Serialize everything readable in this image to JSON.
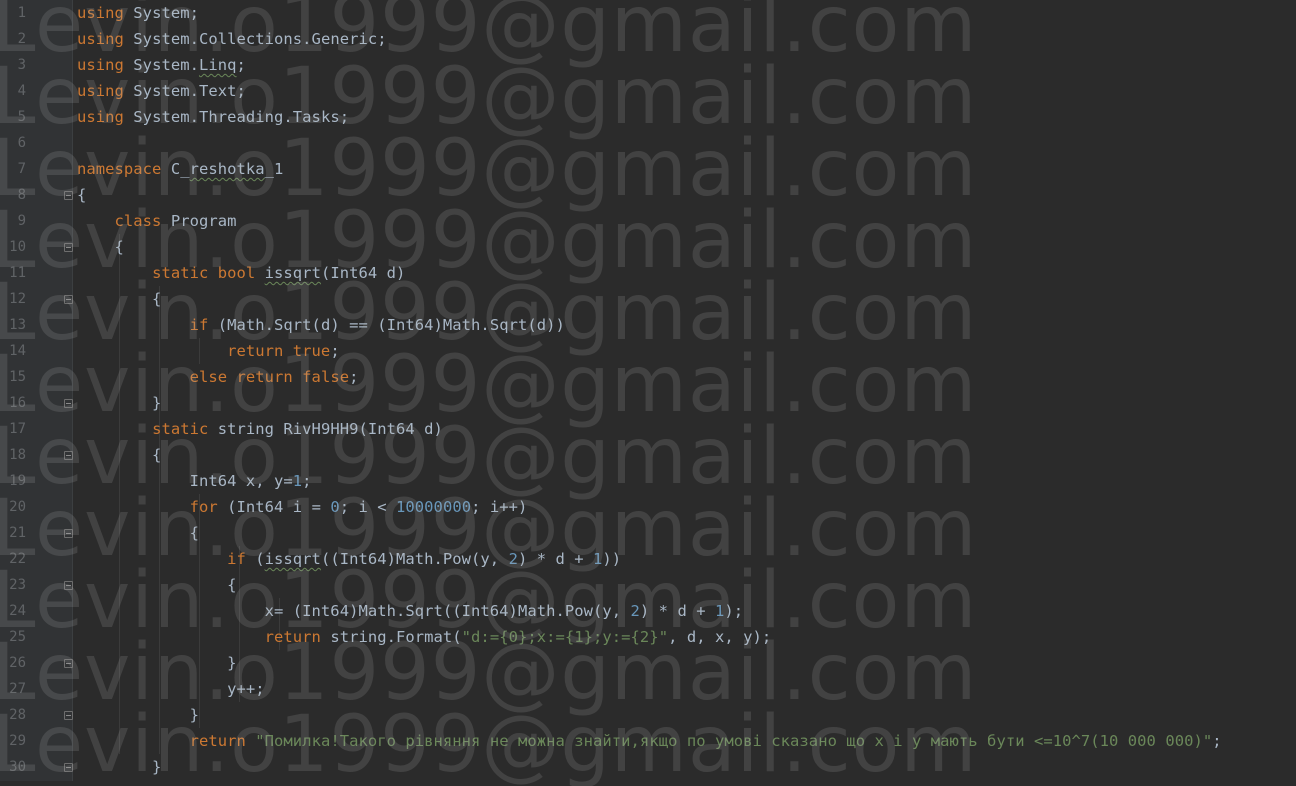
{
  "editor": {
    "line_numbers": [
      "1",
      "2",
      "3",
      "4",
      "5",
      "6",
      "7",
      "8",
      "9",
      "10",
      "11",
      "12",
      "13",
      "14",
      "15",
      "16",
      "17",
      "18",
      "19",
      "20",
      "21",
      "22",
      "23",
      "24",
      "25",
      "26",
      "27",
      "28",
      "29",
      "30"
    ],
    "lines": [
      [
        {
          "t": "using",
          "c": "kw"
        },
        {
          "t": " System;"
        }
      ],
      [
        {
          "t": "using",
          "c": "kw"
        },
        {
          "t": " System.Collections.Generic;"
        }
      ],
      [
        {
          "t": "using",
          "c": "kw"
        },
        {
          "t": " System."
        },
        {
          "t": "Linq",
          "c": "typo"
        },
        {
          "t": ";"
        }
      ],
      [
        {
          "t": "using",
          "c": "kw"
        },
        {
          "t": " System.Text;"
        }
      ],
      [
        {
          "t": "using",
          "c": "kw"
        },
        {
          "t": " System.Threading.Tasks;"
        }
      ],
      [],
      [
        {
          "t": "namespace",
          "c": "kw"
        },
        {
          "t": " C_"
        },
        {
          "t": "reshotka",
          "c": "typo"
        },
        {
          "t": "_1"
        }
      ],
      [
        {
          "t": "{"
        }
      ],
      [
        {
          "t": "    "
        },
        {
          "t": "class",
          "c": "kw"
        },
        {
          "t": " Program"
        }
      ],
      [
        {
          "t": "    {"
        }
      ],
      [
        {
          "t": "        "
        },
        {
          "t": "static bool",
          "c": "kw"
        },
        {
          "t": " "
        },
        {
          "t": "issqrt",
          "c": "typo"
        },
        {
          "t": "(Int64 d)"
        }
      ],
      [
        {
          "t": "        {"
        }
      ],
      [
        {
          "t": "            "
        },
        {
          "t": "if",
          "c": "kw"
        },
        {
          "t": " (Math.Sqrt(d) == (Int64)Math.Sqrt(d))"
        }
      ],
      [
        {
          "t": "                "
        },
        {
          "t": "return true",
          "c": "kw"
        },
        {
          "t": ";"
        }
      ],
      [
        {
          "t": "            "
        },
        {
          "t": "else return false",
          "c": "kw"
        },
        {
          "t": ";"
        }
      ],
      [
        {
          "t": "        }"
        }
      ],
      [
        {
          "t": "        "
        },
        {
          "t": "static",
          "c": "kw"
        },
        {
          "t": " string RivH9HH9(Int64 d)"
        }
      ],
      [
        {
          "t": "        {"
        }
      ],
      [
        {
          "t": "            Int64 x, y="
        },
        {
          "t": "1",
          "c": "num"
        },
        {
          "t": ";"
        }
      ],
      [
        {
          "t": "            "
        },
        {
          "t": "for",
          "c": "kw"
        },
        {
          "t": " (Int64 i = "
        },
        {
          "t": "0",
          "c": "num"
        },
        {
          "t": "; i < "
        },
        {
          "t": "10000000",
          "c": "num"
        },
        {
          "t": "; i++)"
        }
      ],
      [
        {
          "t": "            {"
        }
      ],
      [
        {
          "t": "                "
        },
        {
          "t": "if",
          "c": "kw"
        },
        {
          "t": " ("
        },
        {
          "t": "issqrt",
          "c": "typo"
        },
        {
          "t": "((Int64)Math.Pow(y, "
        },
        {
          "t": "2",
          "c": "num"
        },
        {
          "t": ") * d + "
        },
        {
          "t": "1",
          "c": "num"
        },
        {
          "t": "))"
        }
      ],
      [
        {
          "t": "                {"
        }
      ],
      [
        {
          "t": "                    x= (Int64)Math.Sqrt((Int64)Math.Pow(y, "
        },
        {
          "t": "2",
          "c": "num"
        },
        {
          "t": ") * d + "
        },
        {
          "t": "1",
          "c": "num"
        },
        {
          "t": ");"
        }
      ],
      [
        {
          "t": "                    "
        },
        {
          "t": "return",
          "c": "kw"
        },
        {
          "t": " string.Format("
        },
        {
          "t": "\"d:={0};x:={1};y:={2}\"",
          "c": "str"
        },
        {
          "t": ", d, x, y);"
        }
      ],
      [
        {
          "t": "                }"
        }
      ],
      [
        {
          "t": "                y++;"
        }
      ],
      [
        {
          "t": "            }"
        }
      ],
      [
        {
          "t": "            "
        },
        {
          "t": "return",
          "c": "kw"
        },
        {
          "t": " "
        },
        {
          "t": "\"Помилка!Такого рівняння не можна знайти,якщо по умові сказано що x і y мають бути <=10^7(10 000 000)\"",
          "c": "str"
        },
        {
          "t": ";"
        }
      ],
      [
        {
          "t": "        }"
        }
      ]
    ],
    "fold_markers": [
      {
        "line": 8,
        "kind": "open"
      },
      {
        "line": 10,
        "kind": "open"
      },
      {
        "line": 12,
        "kind": "open"
      },
      {
        "line": 16,
        "kind": "close"
      },
      {
        "line": 18,
        "kind": "open"
      },
      {
        "line": 21,
        "kind": "open"
      },
      {
        "line": 23,
        "kind": "open"
      },
      {
        "line": 26,
        "kind": "close"
      },
      {
        "line": 28,
        "kind": "close"
      },
      {
        "line": 30,
        "kind": "close"
      }
    ]
  },
  "watermark": {
    "text": "Levin.o1999@gmail.com",
    "rows": 11
  },
  "colors": {
    "background": "#2b2b2b",
    "gutter": "#313335",
    "keyword": "#cc7832",
    "number": "#6897bb",
    "string": "#6a8759",
    "text": "#a9b7c6"
  }
}
